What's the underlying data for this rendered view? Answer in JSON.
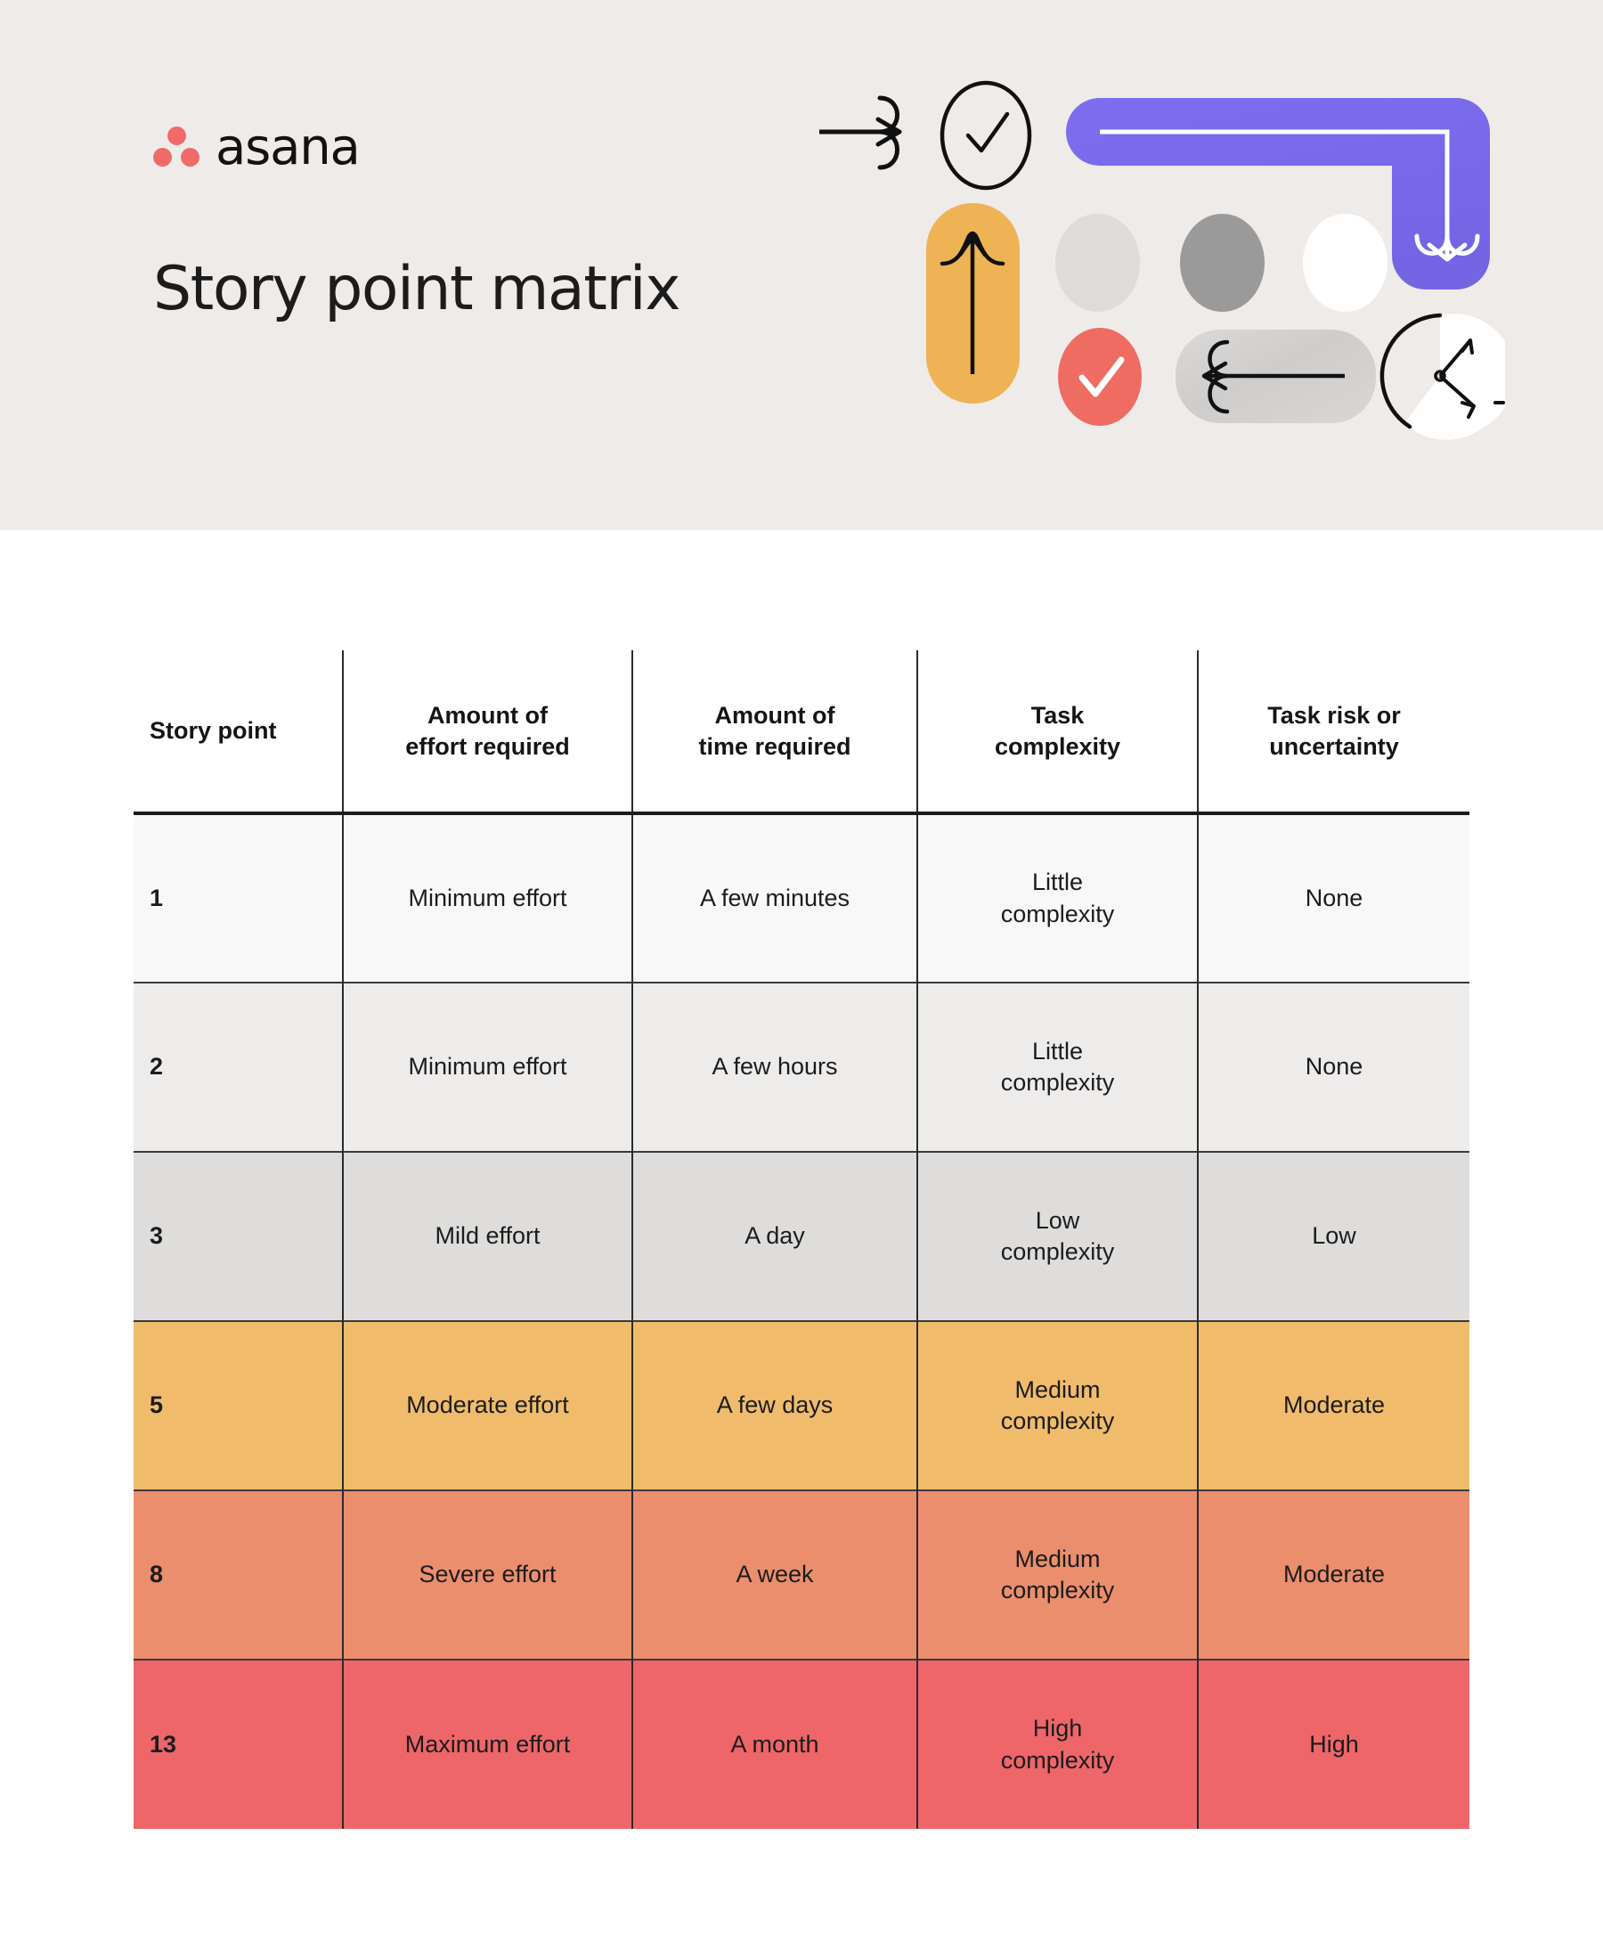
{
  "banner": {
    "brand_name": "asana",
    "title": "Story point matrix",
    "logo_color": "#f06a6a",
    "background": "#eeebe9",
    "decor": [
      {
        "name": "arrow-right-icon",
        "color": "#111111"
      },
      {
        "name": "check-circle-outline-icon",
        "color": "#111111"
      },
      {
        "name": "purple-elbow-arrow-shape",
        "color": "#7b68e8"
      },
      {
        "name": "orange-pill-up-arrow-shape",
        "color": "#eeb355"
      },
      {
        "name": "light-gray-circle-shape",
        "color": "#dedcda"
      },
      {
        "name": "dark-gray-circle-shape",
        "color": "#9a9a9a"
      },
      {
        "name": "white-circle-shape",
        "color": "#ffffff"
      },
      {
        "name": "red-check-circle-icon",
        "color": "#ef6c63"
      },
      {
        "name": "marble-pill-left-arrow-shape",
        "color": "#d8d6d4"
      },
      {
        "name": "clock-icon",
        "color": "#111111"
      }
    ]
  },
  "table": {
    "headers": [
      "Story point",
      "Amount of\neffort required",
      "Amount of\ntime required",
      "Task\ncomplexity",
      "Task risk or\nuncertainty"
    ],
    "rows": [
      {
        "story_point": "1",
        "effort": "Minimum effort",
        "time": "A few minutes",
        "complexity": "Little\ncomplexity",
        "risk": "None",
        "bg": "#f9f8f8"
      },
      {
        "story_point": "2",
        "effort": "Minimum effort",
        "time": "A few hours",
        "complexity": "Little\ncomplexity",
        "risk": "None",
        "bg": "#eeeceb"
      },
      {
        "story_point": "3",
        "effort": "Mild effort",
        "time": "A day",
        "complexity": "Low\ncomplexity",
        "risk": "Low",
        "bg": "#dedddb"
      },
      {
        "story_point": "5",
        "effort": "Moderate effort",
        "time": "A few days",
        "complexity": "Medium\ncomplexity",
        "risk": "Moderate",
        "bg": "#f0bc6c"
      },
      {
        "story_point": "8",
        "effort": "Severe effort",
        "time": "A week",
        "complexity": "Medium\ncomplexity",
        "risk": "Moderate",
        "bg": "#eb8e6e"
      },
      {
        "story_point": "13",
        "effort": "Maximum effort",
        "time": "A month",
        "complexity": "High\ncomplexity",
        "risk": "High",
        "bg": "#ee6669"
      }
    ]
  }
}
